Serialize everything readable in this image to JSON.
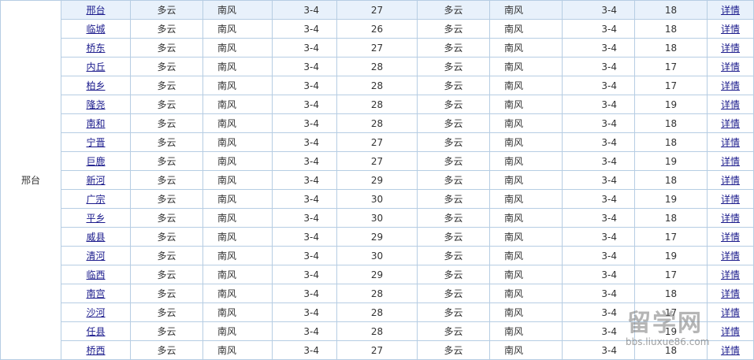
{
  "province": "邢台",
  "detail_label": "详情",
  "rows": [
    {
      "city": "邢台",
      "day_weather": "多云",
      "day_wind": "南风",
      "day_level": "3-4",
      "high": "27",
      "night_weather": "多云",
      "night_wind": "南风",
      "night_level": "3-4",
      "low": "18"
    },
    {
      "city": "临城",
      "day_weather": "多云",
      "day_wind": "南风",
      "day_level": "3-4",
      "high": "26",
      "night_weather": "多云",
      "night_wind": "南风",
      "night_level": "3-4",
      "low": "18"
    },
    {
      "city": "桥东",
      "day_weather": "多云",
      "day_wind": "南风",
      "day_level": "3-4",
      "high": "27",
      "night_weather": "多云",
      "night_wind": "南风",
      "night_level": "3-4",
      "low": "18"
    },
    {
      "city": "内丘",
      "day_weather": "多云",
      "day_wind": "南风",
      "day_level": "3-4",
      "high": "28",
      "night_weather": "多云",
      "night_wind": "南风",
      "night_level": "3-4",
      "low": "17"
    },
    {
      "city": "柏乡",
      "day_weather": "多云",
      "day_wind": "南风",
      "day_level": "3-4",
      "high": "28",
      "night_weather": "多云",
      "night_wind": "南风",
      "night_level": "3-4",
      "low": "17"
    },
    {
      "city": "隆尧",
      "day_weather": "多云",
      "day_wind": "南风",
      "day_level": "3-4",
      "high": "28",
      "night_weather": "多云",
      "night_wind": "南风",
      "night_level": "3-4",
      "low": "19"
    },
    {
      "city": "南和",
      "day_weather": "多云",
      "day_wind": "南风",
      "day_level": "3-4",
      "high": "28",
      "night_weather": "多云",
      "night_wind": "南风",
      "night_level": "3-4",
      "low": "18"
    },
    {
      "city": "宁晋",
      "day_weather": "多云",
      "day_wind": "南风",
      "day_level": "3-4",
      "high": "27",
      "night_weather": "多云",
      "night_wind": "南风",
      "night_level": "3-4",
      "low": "18"
    },
    {
      "city": "巨鹿",
      "day_weather": "多云",
      "day_wind": "南风",
      "day_level": "3-4",
      "high": "27",
      "night_weather": "多云",
      "night_wind": "南风",
      "night_level": "3-4",
      "low": "19"
    },
    {
      "city": "新河",
      "day_weather": "多云",
      "day_wind": "南风",
      "day_level": "3-4",
      "high": "29",
      "night_weather": "多云",
      "night_wind": "南风",
      "night_level": "3-4",
      "low": "18"
    },
    {
      "city": "广宗",
      "day_weather": "多云",
      "day_wind": "南风",
      "day_level": "3-4",
      "high": "30",
      "night_weather": "多云",
      "night_wind": "南风",
      "night_level": "3-4",
      "low": "19"
    },
    {
      "city": "平乡",
      "day_weather": "多云",
      "day_wind": "南风",
      "day_level": "3-4",
      "high": "30",
      "night_weather": "多云",
      "night_wind": "南风",
      "night_level": "3-4",
      "low": "18"
    },
    {
      "city": "威县",
      "day_weather": "多云",
      "day_wind": "南风",
      "day_level": "3-4",
      "high": "29",
      "night_weather": "多云",
      "night_wind": "南风",
      "night_level": "3-4",
      "low": "17"
    },
    {
      "city": "清河",
      "day_weather": "多云",
      "day_wind": "南风",
      "day_level": "3-4",
      "high": "30",
      "night_weather": "多云",
      "night_wind": "南风",
      "night_level": "3-4",
      "low": "19"
    },
    {
      "city": "临西",
      "day_weather": "多云",
      "day_wind": "南风",
      "day_level": "3-4",
      "high": "29",
      "night_weather": "多云",
      "night_wind": "南风",
      "night_level": "3-4",
      "low": "17"
    },
    {
      "city": "南宫",
      "day_weather": "多云",
      "day_wind": "南风",
      "day_level": "3-4",
      "high": "28",
      "night_weather": "多云",
      "night_wind": "南风",
      "night_level": "3-4",
      "low": "18"
    },
    {
      "city": "沙河",
      "day_weather": "多云",
      "day_wind": "南风",
      "day_level": "3-4",
      "high": "28",
      "night_weather": "多云",
      "night_wind": "南风",
      "night_level": "3-4",
      "low": "17"
    },
    {
      "city": "任县",
      "day_weather": "多云",
      "day_wind": "南风",
      "day_level": "3-4",
      "high": "28",
      "night_weather": "多云",
      "night_wind": "南风",
      "night_level": "3-4",
      "low": "19"
    },
    {
      "city": "桥西",
      "day_weather": "多云",
      "day_wind": "南风",
      "day_level": "3-4",
      "high": "27",
      "night_weather": "多云",
      "night_wind": "南风",
      "night_level": "3-4",
      "low": "18"
    }
  ],
  "watermark": {
    "title": "留学网",
    "url": "bbs.liuxue86.com"
  },
  "colors": {
    "border": "#b6cde3",
    "highlight_row": "#e8f1fb",
    "link": "#1a1a8c"
  }
}
